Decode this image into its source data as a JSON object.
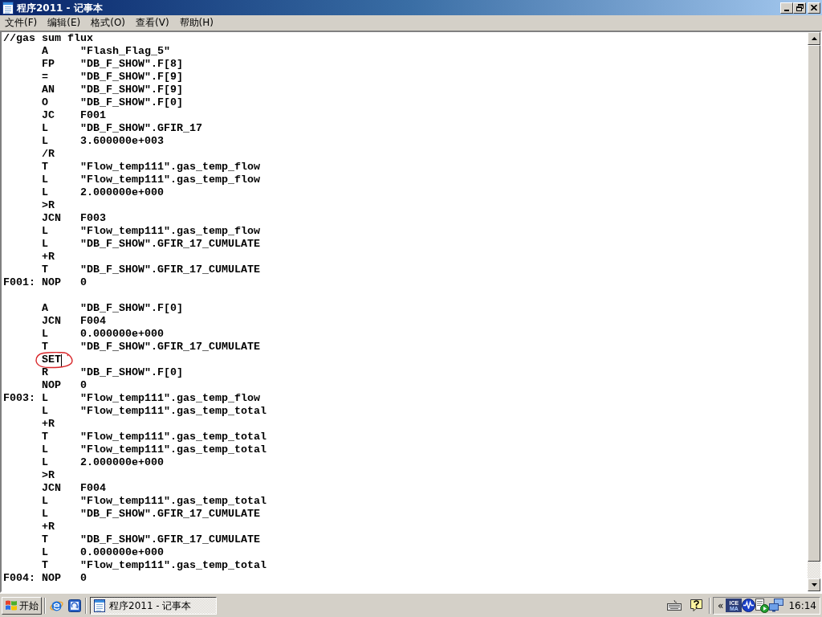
{
  "window": {
    "title": "程序2011 - 记事本",
    "controls": [
      {
        "kind": "minimize"
      },
      {
        "kind": "restore"
      },
      {
        "kind": "close"
      }
    ]
  },
  "menu": [
    "文件(F)",
    "编辑(E)",
    "格式(O)",
    "查看(V)",
    "帮助(H)"
  ],
  "editor": {
    "lines": [
      {
        "kind": "comment",
        "text": "//gas sum flux",
        "circled": false,
        "caret": false
      },
      {
        "kind": "instruction",
        "op": "A",
        "operand": "\"Flash_Flag_5\"",
        "circled": false,
        "caret": false
      },
      {
        "kind": "instruction",
        "op": "FP",
        "operand": "\"DB_F_SHOW\".F[8]",
        "circled": false,
        "caret": false
      },
      {
        "kind": "instruction",
        "op": "=",
        "operand": "\"DB_F_SHOW\".F[9]",
        "circled": false,
        "caret": false
      },
      {
        "kind": "instruction",
        "op": "AN",
        "operand": "\"DB_F_SHOW\".F[9]",
        "circled": false,
        "caret": false
      },
      {
        "kind": "instruction",
        "op": "O",
        "operand": "\"DB_F_SHOW\".F[0]",
        "circled": false,
        "caret": false
      },
      {
        "kind": "instruction",
        "op": "JC",
        "operand": "F001",
        "circled": false,
        "caret": false
      },
      {
        "kind": "instruction",
        "op": "L",
        "operand": "\"DB_F_SHOW\".GFIR_17",
        "circled": false,
        "caret": false
      },
      {
        "kind": "instruction",
        "op": "L",
        "operand": "3.600000e+003",
        "circled": false,
        "caret": false
      },
      {
        "kind": "instruction",
        "op": "/R",
        "circled": false,
        "caret": false
      },
      {
        "kind": "instruction",
        "op": "T",
        "operand": "\"Flow_temp111\".gas_temp_flow",
        "circled": false,
        "caret": false
      },
      {
        "kind": "instruction",
        "op": "L",
        "operand": "\"Flow_temp111\".gas_temp_flow",
        "circled": false,
        "caret": false
      },
      {
        "kind": "instruction",
        "op": "L",
        "operand": "2.000000e+000",
        "circled": false,
        "caret": false
      },
      {
        "kind": "instruction",
        "op": ">R",
        "circled": false,
        "caret": false
      },
      {
        "kind": "instruction",
        "op": "JCN",
        "operand": "F003",
        "circled": false,
        "caret": false
      },
      {
        "kind": "instruction",
        "op": "L",
        "operand": "\"Flow_temp111\".gas_temp_flow",
        "circled": false,
        "caret": false
      },
      {
        "kind": "instruction",
        "op": "L",
        "operand": "\"DB_F_SHOW\".GFIR_17_CUMULATE",
        "circled": false,
        "caret": false
      },
      {
        "kind": "instruction",
        "op": "+R",
        "circled": false,
        "caret": false
      },
      {
        "kind": "instruction",
        "op": "T",
        "operand": "\"DB_F_SHOW\".GFIR_17_CUMULATE",
        "circled": false,
        "caret": false
      },
      {
        "kind": "instruction",
        "label": "F001:",
        "op": "NOP",
        "operand": "0",
        "circled": false,
        "caret": false
      },
      {
        "kind": "blank",
        "circled": false,
        "caret": false
      },
      {
        "kind": "instruction",
        "op": "A",
        "operand": "\"DB_F_SHOW\".F[0]",
        "circled": false,
        "caret": false
      },
      {
        "kind": "instruction",
        "op": "JCN",
        "operand": "F004",
        "circled": false,
        "caret": false
      },
      {
        "kind": "instruction",
        "op": "L",
        "operand": "0.000000e+000",
        "circled": false,
        "caret": false
      },
      {
        "kind": "instruction",
        "op": "T",
        "operand": "\"DB_F_SHOW\".GFIR_17_CUMULATE",
        "circled": false,
        "caret": false
      },
      {
        "kind": "instruction",
        "op": "SET",
        "circled": true,
        "caret": true
      },
      {
        "kind": "instruction",
        "op": "R",
        "operand": "\"DB_F_SHOW\".F[0]",
        "circled": false,
        "caret": false
      },
      {
        "kind": "instruction",
        "op": "NOP",
        "operand": "0",
        "circled": false,
        "caret": false
      },
      {
        "kind": "instruction",
        "label": "F003:",
        "op": "L",
        "operand": "\"Flow_temp111\".gas_temp_flow",
        "circled": false,
        "caret": false
      },
      {
        "kind": "instruction",
        "op": "L",
        "operand": "\"Flow_temp111\".gas_temp_total",
        "circled": false,
        "caret": false
      },
      {
        "kind": "instruction",
        "op": "+R",
        "circled": false,
        "caret": false
      },
      {
        "kind": "instruction",
        "op": "T",
        "operand": "\"Flow_temp111\".gas_temp_total",
        "circled": false,
        "caret": false
      },
      {
        "kind": "instruction",
        "op": "L",
        "operand": "\"Flow_temp111\".gas_temp_total",
        "circled": false,
        "caret": false
      },
      {
        "kind": "instruction",
        "op": "L",
        "operand": "2.000000e+000",
        "circled": false,
        "caret": false
      },
      {
        "kind": "instruction",
        "op": ">R",
        "circled": false,
        "caret": false
      },
      {
        "kind": "instruction",
        "op": "JCN",
        "operand": "F004",
        "circled": false,
        "caret": false
      },
      {
        "kind": "instruction",
        "op": "L",
        "operand": "\"Flow_temp111\".gas_temp_total",
        "circled": false,
        "caret": false
      },
      {
        "kind": "instruction",
        "op": "L",
        "operand": "\"DB_F_SHOW\".GFIR_17_CUMULATE",
        "circled": false,
        "caret": false
      },
      {
        "kind": "instruction",
        "op": "+R",
        "circled": false,
        "caret": false
      },
      {
        "kind": "instruction",
        "op": "T",
        "operand": "\"DB_F_SHOW\".GFIR_17_CUMULATE",
        "circled": false,
        "caret": false
      },
      {
        "kind": "instruction",
        "op": "L",
        "operand": "0.000000e+000",
        "circled": false,
        "caret": false
      },
      {
        "kind": "instruction",
        "op": "T",
        "operand": "\"Flow_temp111\".gas_temp_total",
        "circled": false,
        "caret": false
      },
      {
        "kind": "instruction",
        "label": "F004:",
        "op": "NOP",
        "operand": "0",
        "circled": false,
        "caret": false
      }
    ]
  },
  "taskbar": {
    "start_button": {
      "label": "开始"
    },
    "quick_launch": [
      {
        "kind": "browser"
      },
      {
        "kind": "desktop"
      }
    ],
    "tasks": [
      {
        "title": "程序2011 - 记事本",
        "active": true
      }
    ],
    "tools": [
      {
        "kind": "keyboard"
      },
      {
        "kind": "help"
      }
    ],
    "tray": {
      "toggle": "«",
      "icons": [
        {
          "kind": "tile",
          "top": "ICE",
          "bottom": "MA"
        },
        {
          "kind": "wave"
        },
        {
          "kind": "document_play"
        },
        {
          "kind": "network"
        }
      ],
      "clock": "16:14"
    }
  }
}
